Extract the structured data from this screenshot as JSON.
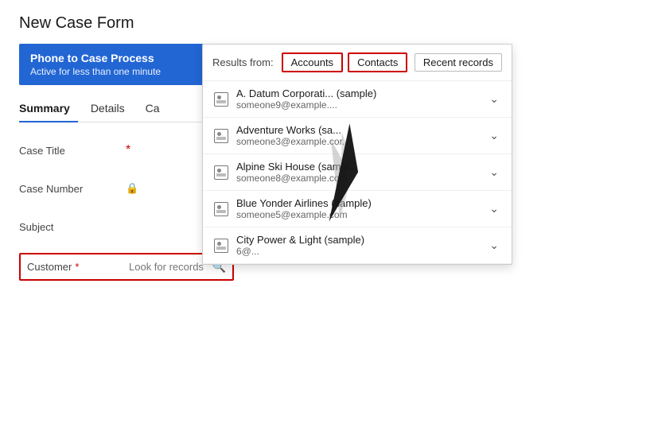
{
  "page": {
    "title": "New Case Form"
  },
  "process_bar": {
    "title": "Phone to Case Process",
    "subtitle": "Active for less than one minute"
  },
  "tabs": [
    {
      "label": "Summary",
      "active": true
    },
    {
      "label": "Details",
      "active": false
    },
    {
      "label": "Ca...",
      "active": false
    }
  ],
  "fields": [
    {
      "label": "Case Title",
      "required": true,
      "locked": false
    },
    {
      "label": "Case Number",
      "required": false,
      "locked": true
    },
    {
      "label": "Subject",
      "required": false,
      "locked": false
    }
  ],
  "customer_field": {
    "label": "Customer",
    "required": true,
    "placeholder": "Look for records",
    "required_star": "*"
  },
  "dropdown": {
    "results_from_label": "Results from:",
    "filter_buttons": [
      "Accounts",
      "Contacts"
    ],
    "recent_button": "Recent records",
    "items": [
      {
        "name": "A. Datum Corporati... (sample)",
        "email": "someone9@example...."
      },
      {
        "name": "Adventure Works (sa...",
        "email": "someone3@example.cor..."
      },
      {
        "name": "Alpine Ski House (sampl...",
        "email": "someone8@example.com"
      },
      {
        "name": "Blue Yonder Airlines (sample)",
        "email": "someone5@example.com"
      },
      {
        "name": "City Power & Light (sample)",
        "email": "6@..."
      }
    ]
  },
  "colors": {
    "accent_blue": "#2266d4",
    "required_red": "#c00",
    "border_highlight": "#c00"
  }
}
